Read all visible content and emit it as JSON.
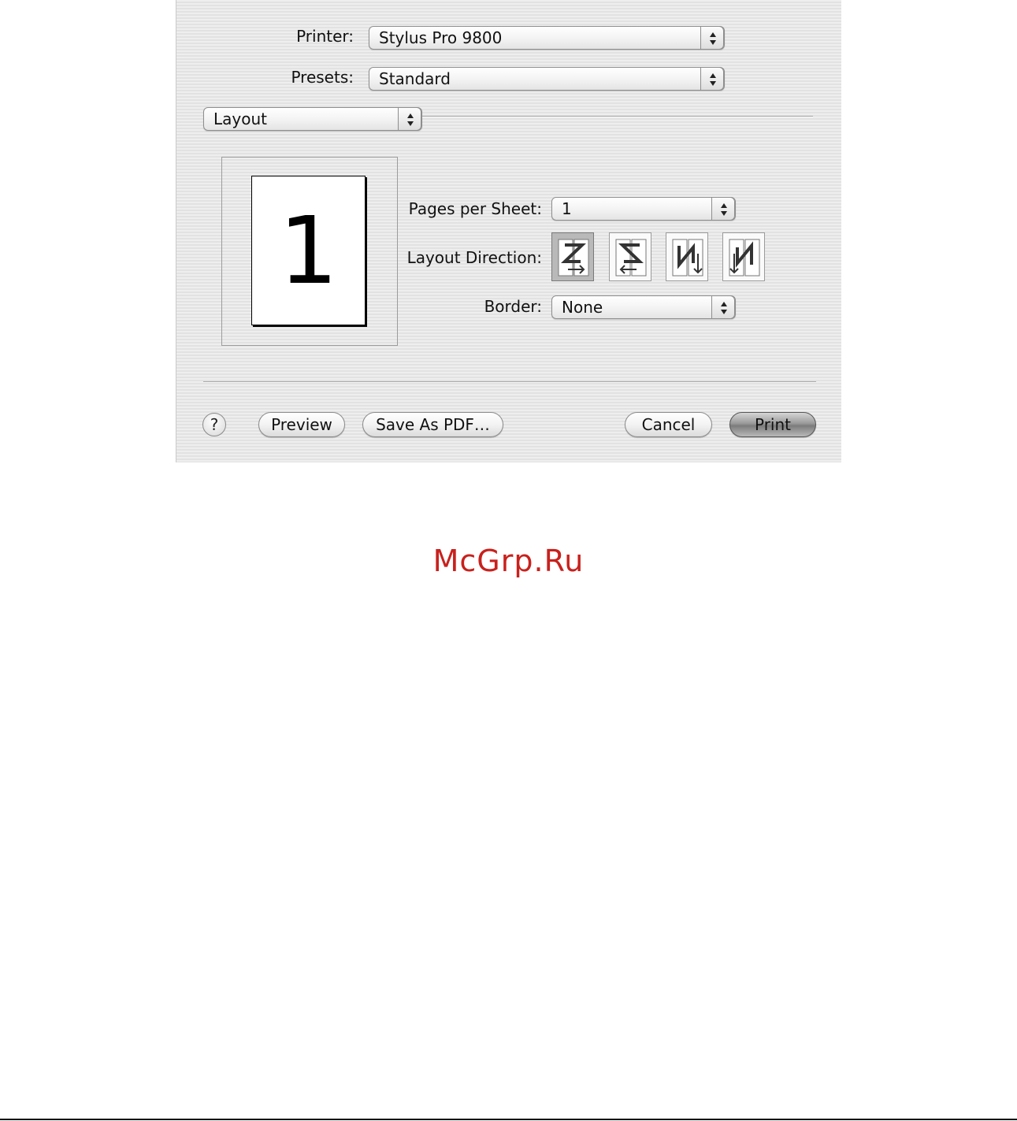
{
  "printer": {
    "label": "Printer:",
    "value": "Stylus Pro 9800"
  },
  "presets": {
    "label": "Presets:",
    "value": "Standard"
  },
  "panel": {
    "value": "Layout"
  },
  "preview": {
    "page_number": "1"
  },
  "pages_per_sheet": {
    "label": "Pages per Sheet:",
    "value": "1"
  },
  "layout_direction": {
    "label": "Layout Direction:",
    "options": [
      "left-right-top-bottom-icon",
      "right-left-top-bottom-icon",
      "top-bottom-left-right-icon",
      "top-bottom-right-left-icon"
    ],
    "selected_index": 0
  },
  "border": {
    "label": "Border:",
    "value": "None"
  },
  "buttons": {
    "help": "?",
    "preview": "Preview",
    "save_pdf": "Save As PDF…",
    "cancel": "Cancel",
    "print": "Print"
  },
  "watermark": "McGrp.Ru"
}
